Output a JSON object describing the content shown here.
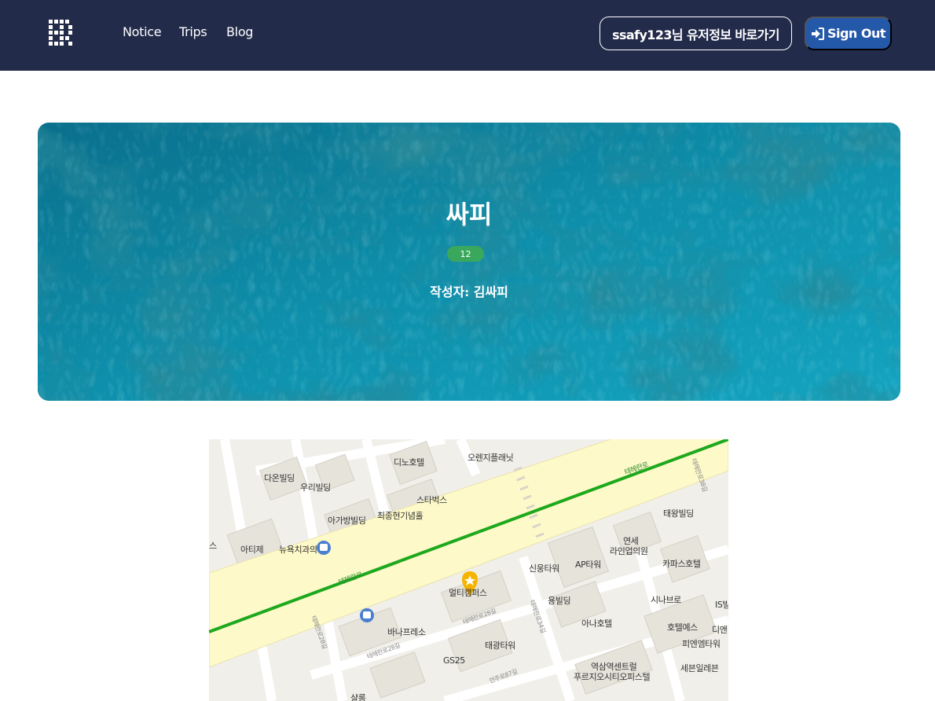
{
  "navbar": {
    "logo_icon": "pixel-logo-icon",
    "links": [
      "Notice",
      "Trips",
      "Blog"
    ],
    "user_button": "ssafy123님 유저정보 바로가기",
    "signout_button": "Sign Out",
    "signout_icon": "sign-in-arrow-icon",
    "colors": {
      "background": "#232b4b",
      "signout_bg": "#2458a8"
    }
  },
  "hero": {
    "title": "싸피",
    "badge": "12",
    "author": "작성자: 김싸피",
    "background": "ocean-water-image",
    "colors": {
      "badge": "#3aa85c",
      "water": "#0d8aa8"
    }
  },
  "map": {
    "labels": [
      "디노호텔",
      "오렌지플래닛",
      "다온빌딩",
      "우리빌딩",
      "스타벅스",
      "최종현기념홀",
      "아가방빌딩",
      "태왕빌딩",
      "연세",
      "라인업의원",
      "아티제",
      "뉴욕치과의",
      "카파스호텔",
      "신웅타워",
      "AP타워",
      "멀티캠퍼스",
      "용빌딩",
      "시나브로",
      "아나호텔",
      "호텔예스",
      "바나프레소",
      "태광타워",
      "피엔엠타워",
      "역삼역센트럴",
      "푸르지오시티오피스텔",
      "세븐일레븐",
      "GS25",
      "디앤",
      "IS빌",
      "스",
      "샬롬"
    ],
    "road_labels": [
      "테헤란로",
      "테헤란로",
      "테헤란로28길",
      "테헤란로34길",
      "테헤란로38길",
      "테헤란로28길",
      "테헤란로28길",
      "언주로87길"
    ],
    "marker_icon": "star-pin-icon"
  }
}
